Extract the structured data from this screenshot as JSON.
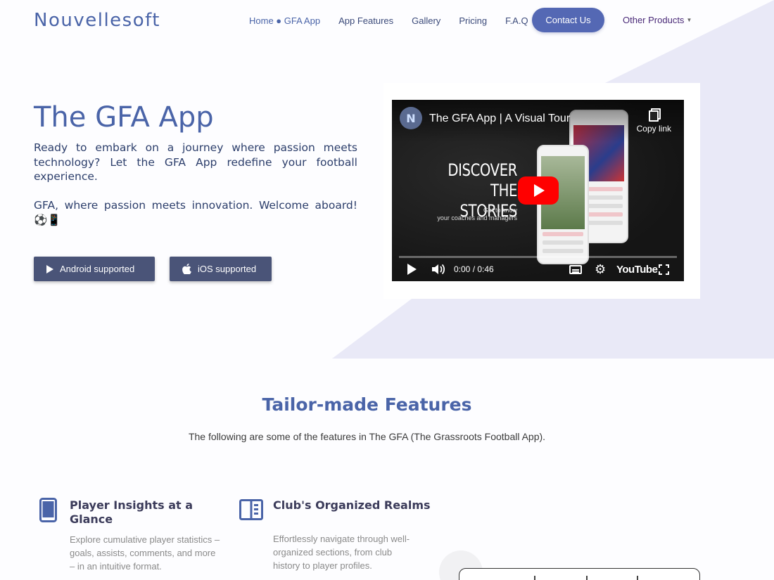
{
  "brand": {
    "logo": "Nouvellesoft"
  },
  "nav": {
    "home": "Home ● GFA App",
    "items": [
      "App Features",
      "Gallery",
      "Pricing",
      "F.A.Q"
    ],
    "contact": "Contact Us",
    "other_products": "Other Products"
  },
  "hero": {
    "title": "The GFA App",
    "paragraph1": "Ready to embark on a journey where passion meets technology? Let the GFA App redefine your football experience.",
    "paragraph2": "GFA, where passion meets innovation. Welcome aboard! ⚽📱",
    "android_button": "Android supported",
    "ios_button": "iOS supported"
  },
  "video": {
    "title": "The GFA App | A Visual Tour",
    "copy_link": "Copy link",
    "overlay_heading_line1": "DISCOVER",
    "overlay_heading_line2": "THE STORIES",
    "overlay_sub_line1": "Get to know",
    "overlay_sub_line2": "your coaches and managers",
    "time": "0:00 / 0:46",
    "youtube_label": "YouTube",
    "progress": 0
  },
  "features": {
    "title": "Tailor-made Features",
    "subtitle": "The following are some of the features in The GFA (The Grassroots Football App).",
    "items": [
      {
        "title": "Player Insights at a Glance",
        "text": "Explore cumulative player statistics – goals, assists, comments, and more – in an intuitive format.",
        "icon": "tablet-icon"
      },
      {
        "title": "Club's Organized Realms",
        "text": "Effortlessly navigate through well-organized sections, from club history to player profiles.",
        "icon": "layout-icon"
      }
    ]
  },
  "colors": {
    "accent": "#4a64a8",
    "button": "#5468b4",
    "store_button": "#4a5478",
    "background_shape": "#e9e9f7"
  }
}
